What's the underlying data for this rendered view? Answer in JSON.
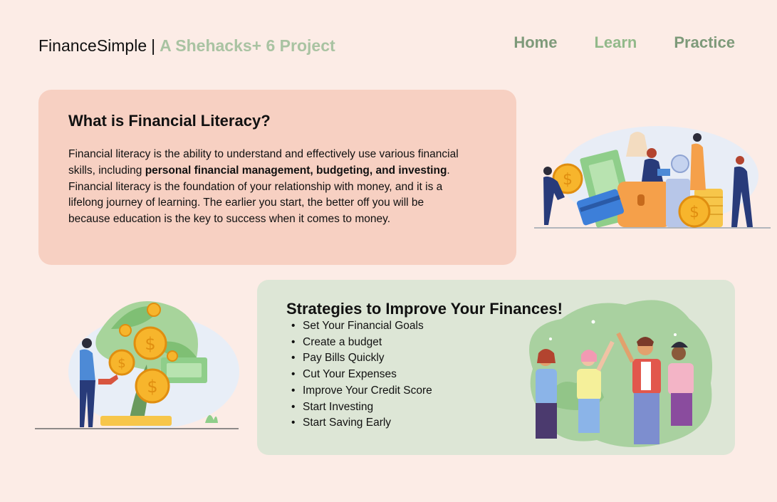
{
  "header": {
    "brand_name": "FinanceSimple",
    "brand_separator": "|",
    "brand_tagline": "A Shehacks+ 6 Project",
    "nav": [
      {
        "label": "Home"
      },
      {
        "label": "Learn"
      },
      {
        "label": "Practice"
      }
    ]
  },
  "literacy": {
    "title": "What is Financial Literacy?",
    "text_1": "Financial literacy is the ability to understand and effectively use various financial skills, including ",
    "text_bold": "personal financial management, budgeting, and investing",
    "text_2": ". Financial literacy is the foundation of your relationship with money, and it is a lifelong journey of learning. The earlier you start, the better off you will be because education is the key to success when it comes to money."
  },
  "strategies": {
    "title": "Strategies to Improve Your Finances!",
    "items": [
      "Set Your Financial Goals",
      "Create a budget",
      "Pay Bills Quickly",
      "Cut Your Expenses",
      "Improve Your Credit Score",
      "Start Investing",
      "Start Saving Early"
    ]
  },
  "colors": {
    "background": "#fcece6",
    "literacy_card": "#f7d0c2",
    "strategies_card": "#dde6d6",
    "nav_text": "#7e9a7a",
    "tagline": "#a9c3a2"
  }
}
